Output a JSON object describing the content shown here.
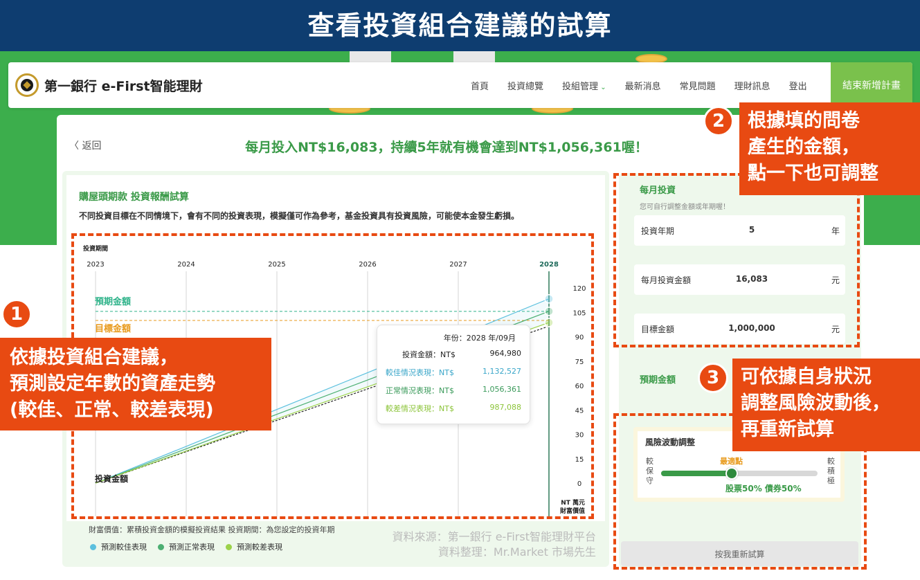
{
  "banner_title": "查看投資組合建議的試算",
  "nav": {
    "brand": "第一銀行 e-First智能理財",
    "links": [
      "首頁",
      "投資總覽",
      "投組管理",
      "最新消息",
      "常見問題",
      "理財訊息",
      "登出"
    ],
    "cta": "結束新增計畫"
  },
  "back_label": "返回",
  "headline": "每月投入NT$16,083，持續5年就有機會達到NT$1,056,361喔！",
  "goal": {
    "title": "購屋頭期款  投資報酬試算",
    "desc": "不同投資目標在不同情境下，會有不同的投資表現，模擬僅可作為參考，基金投資具有投資風險，可能使本金發生虧損。"
  },
  "chart_labels": {
    "period_label": "投資期間",
    "expected_label": "預期金額",
    "target_label": "目標金額",
    "invest_label": "投資金額",
    "unit_label_1": "NT 萬元",
    "unit_label_2": "財富價值"
  },
  "chart_data": {
    "type": "line",
    "x": [
      "2023",
      "2024",
      "2025",
      "2026",
      "2027",
      "2028"
    ],
    "ylim": [
      0,
      120
    ],
    "yticks": [
      0,
      15,
      30,
      45,
      60,
      75,
      90,
      105,
      120
    ],
    "series": [
      {
        "name": "投資金額",
        "color": "#222222",
        "values": [
          0,
          19.3,
          38.6,
          57.9,
          77.2,
          96.5
        ]
      },
      {
        "name": "預測較佳表現",
        "color": "#5bc0de",
        "values": [
          0,
          22.6,
          45.3,
          67.9,
          90.6,
          113.3
        ]
      },
      {
        "name": "預測正常表現",
        "color": "#4caf72",
        "values": [
          0,
          21.1,
          42.3,
          63.4,
          84.5,
          105.6
        ]
      },
      {
        "name": "預測較差表現",
        "color": "#9bd24a",
        "values": [
          0,
          19.7,
          39.5,
          59.2,
          79.0,
          98.7
        ]
      }
    ],
    "expected_amount_line": 105.6,
    "target_amount_line": 100
  },
  "tooltip": {
    "header": "年份：2028 年/09月",
    "rows": [
      {
        "label": "投資金額：NT$",
        "value": "964,980",
        "color": "#222222"
      },
      {
        "label": "較佳情況表現：NT$",
        "value": "1,132,527",
        "color": "#3aa6c9"
      },
      {
        "label": "正常情況表現：NT$",
        "value": "1,056,361",
        "color": "#3a9a5a"
      },
      {
        "label": "較差情況表現：NT$",
        "value": "987,088",
        "color": "#8cc43a"
      }
    ]
  },
  "wealth_note": "財富價值：累積投資金額的模擬投資結果  投資期間：為您設定的投資年期",
  "legend": [
    {
      "label": "預測較佳表現",
      "color": "#5bc0de"
    },
    {
      "label": "預測正常表現",
      "color": "#4caf72"
    },
    {
      "label": "預測較差表現",
      "color": "#9bd24a"
    }
  ],
  "source": {
    "line1": "資料來源：第一銀行 e-First智能理財平台",
    "line2": "資料整理：Mr.Market 市場先生"
  },
  "monthly": {
    "title": "每月投資",
    "subtitle": "您可自行調整金額或年期喔！",
    "fields": [
      {
        "label": "投資年期",
        "value": "5",
        "unit": "年"
      },
      {
        "label": "每月投資金額",
        "value": "16,083",
        "unit": "元"
      },
      {
        "label": "目標金額",
        "value": "1,000,000",
        "unit": "元"
      }
    ]
  },
  "expected_label": "預期金額",
  "risk": {
    "title": "風險波動調整",
    "best": "最適點",
    "left": "較保守",
    "right": "較積極",
    "level": 0.45,
    "mix": "股票50% 債券50%"
  },
  "recalc_label": "按我重新試算",
  "callouts": [
    {
      "num": "1",
      "text": "依據投資組合建議，\n預測設定年數的資產走勢\n(較佳、正常、較差表現)"
    },
    {
      "num": "2",
      "text": "根據填的問卷\n產生的金額，\n點一下也可調整"
    },
    {
      "num": "3",
      "text": "可依據自身狀況\n調整風險波動後，\n再重新試算"
    }
  ]
}
